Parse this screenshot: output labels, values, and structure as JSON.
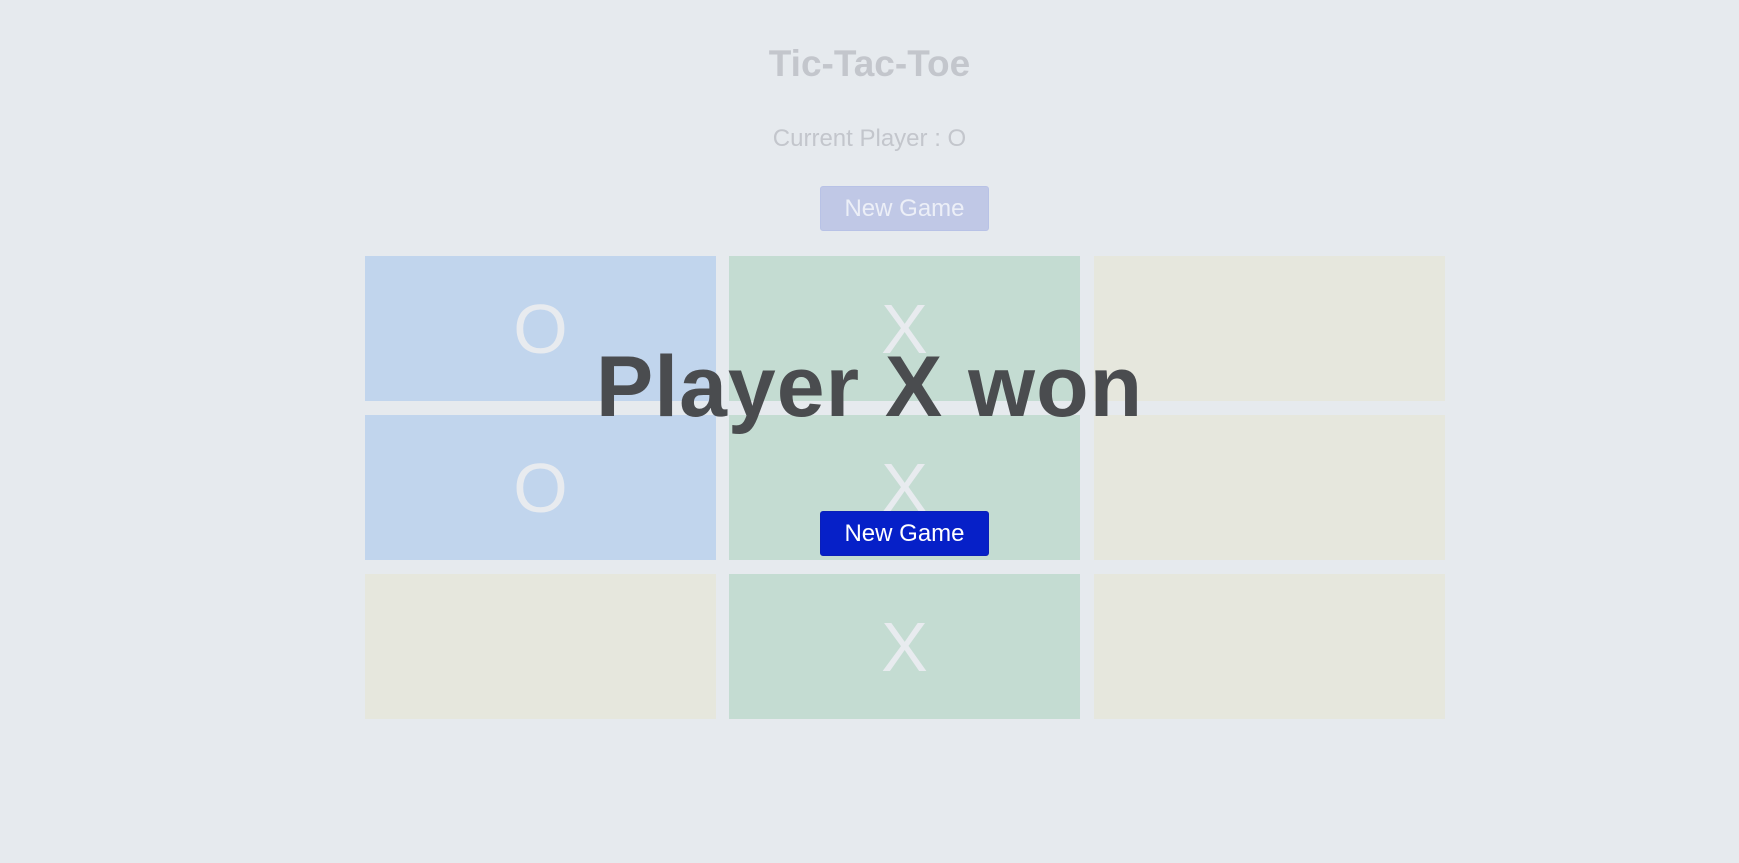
{
  "game": {
    "title": "Tic-Tac-Toe",
    "current_player_text": "Current Player : O",
    "new_game_label": "New Game"
  },
  "board": {
    "cells": [
      {
        "mark": "O",
        "owner": "O"
      },
      {
        "mark": "X",
        "owner": "X"
      },
      {
        "mark": "",
        "owner": ""
      },
      {
        "mark": "O",
        "owner": "O"
      },
      {
        "mark": "X",
        "owner": "X"
      },
      {
        "mark": "",
        "owner": ""
      },
      {
        "mark": "",
        "owner": ""
      },
      {
        "mark": "X",
        "owner": "X"
      },
      {
        "mark": "",
        "owner": ""
      }
    ]
  },
  "result_overlay": {
    "message": "Player X won",
    "new_game_label": "New Game"
  },
  "colors": {
    "o_cell": "#c1d5ed",
    "x_cell": "#c4dcd2",
    "empty_cell": "#e6e7dd",
    "overlay_button": "#0620c8",
    "background": "#e6eaee"
  }
}
